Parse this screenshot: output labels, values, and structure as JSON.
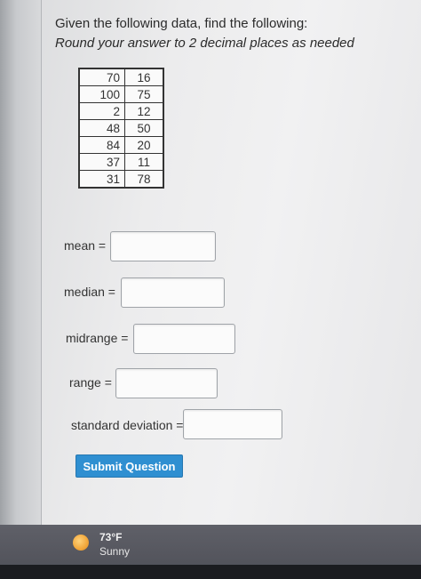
{
  "question": {
    "title": "Given the following data, find the following:",
    "instruction": "Round your answer to 2 decimal places as needed"
  },
  "data_table": {
    "rows": [
      [
        "70",
        "16"
      ],
      [
        "100",
        "75"
      ],
      [
        "2",
        "12"
      ],
      [
        "48",
        "50"
      ],
      [
        "84",
        "20"
      ],
      [
        "37",
        "11"
      ],
      [
        "31",
        "78"
      ]
    ]
  },
  "fields": {
    "mean_label": "mean =",
    "median_label": "median =",
    "midrange_label": "midrange =",
    "range_label": "range =",
    "std_label": "standard deviation ="
  },
  "actions": {
    "submit_label": "Submit Question"
  },
  "taskbar": {
    "weather_temp": "73°F",
    "weather_condition": "Sunny",
    "weather_icon": "sun-icon"
  }
}
